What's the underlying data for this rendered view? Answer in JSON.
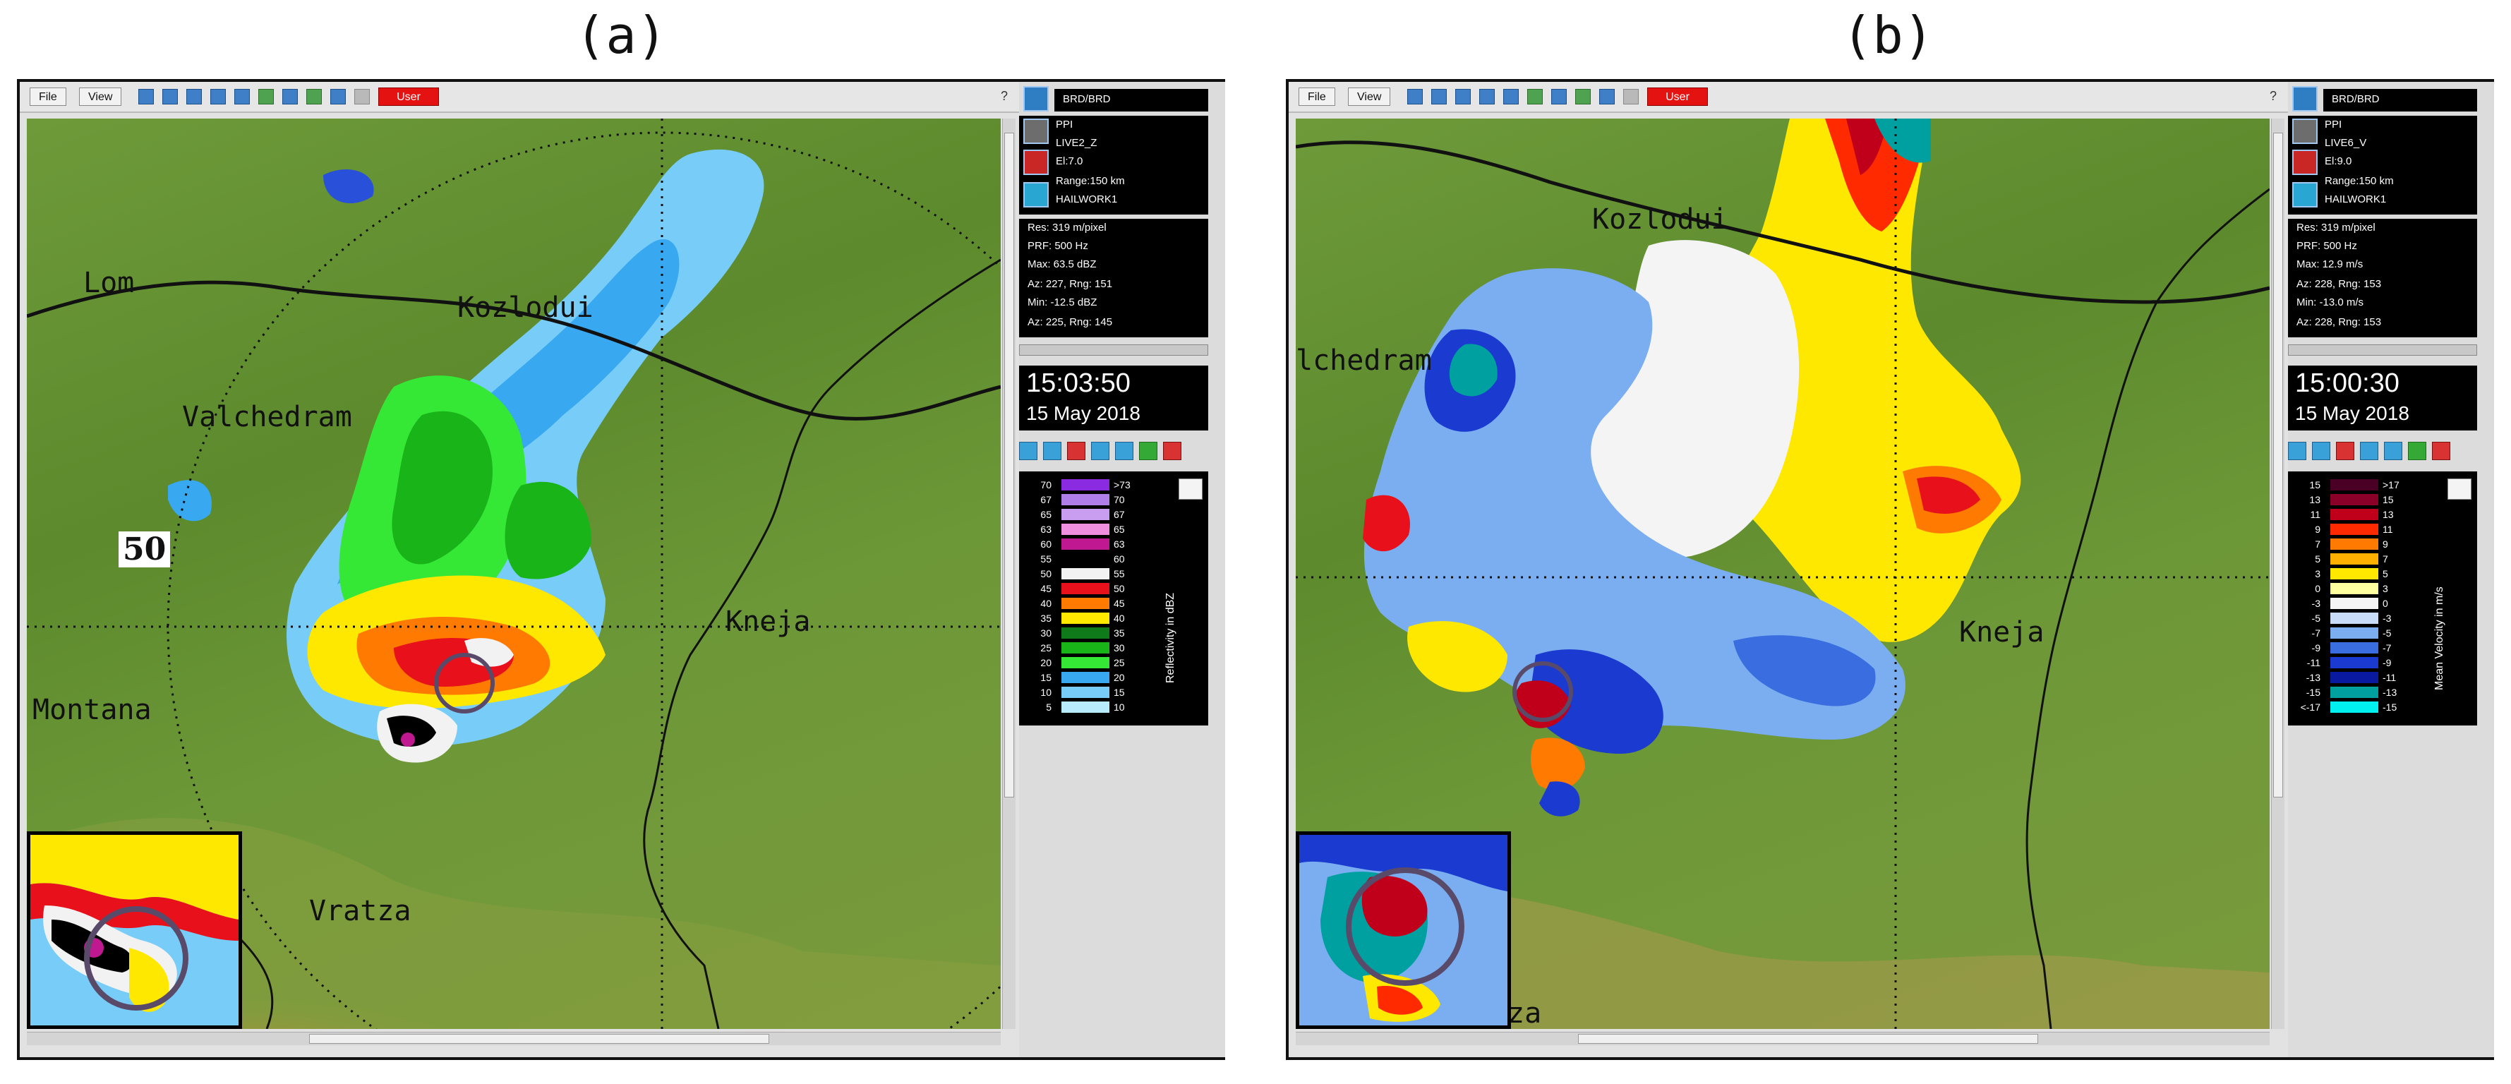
{
  "panels": [
    {
      "id": "a",
      "label": "(a)",
      "toolbar": {
        "file_label": "File",
        "view_label": "View",
        "user_label": "User",
        "help_label": "?"
      },
      "site": "BRD/BRD",
      "scan_type": "PPI",
      "product": "LIVE2_Z",
      "elevation": "El:7.0",
      "range": "Range:150 km",
      "task": "HAILWORK1",
      "stats": [
        "Res: 319 m/pixel",
        "PRF: 500 Hz",
        "Max: 63.5 dBZ",
        "Az:  227, Rng: 151",
        "Min: -12.5 dBZ",
        "Az:  225, Rng: 145"
      ],
      "time": "15:03:50",
      "date": "15 May 2018",
      "legend_title": "Reflectivity in dBZ",
      "legend": [
        {
          "left": "70",
          "color": "#8a2be2",
          "right": ">73"
        },
        {
          "left": "67",
          "color": "#b07ee8",
          "right": "70"
        },
        {
          "left": "65",
          "color": "#c99ef0",
          "right": "67"
        },
        {
          "left": "63",
          "color": "#f08ee0",
          "right": "65"
        },
        {
          "left": "60",
          "color": "#c01890",
          "right": "63"
        },
        {
          "left": "55",
          "color": "#000000",
          "right": "60"
        },
        {
          "left": "50",
          "color": "#f2f2f2",
          "right": "55"
        },
        {
          "left": "45",
          "color": "#e8101a",
          "right": "50"
        },
        {
          "left": "40",
          "color": "#ff7a00",
          "right": "45"
        },
        {
          "left": "35",
          "color": "#ffe800",
          "right": "40"
        },
        {
          "left": "30",
          "color": "#0f7a1a",
          "right": "35"
        },
        {
          "left": "25",
          "color": "#18b418",
          "right": "30"
        },
        {
          "left": "20",
          "color": "#36e836",
          "right": "25"
        },
        {
          "left": "15",
          "color": "#38a8f0",
          "right": "20"
        },
        {
          "left": "10",
          "color": "#78ccf8",
          "right": "15"
        },
        {
          "left": "5",
          "color": "#b8ecfc",
          "right": "10"
        }
      ],
      "places": [
        "Lom",
        "Kozlodui",
        "Valchedram",
        "Kneja",
        "Montana",
        "Vratza"
      ],
      "ring_label": "50"
    },
    {
      "id": "b",
      "label": "(b)",
      "toolbar": {
        "file_label": "File",
        "view_label": "View",
        "user_label": "User",
        "help_label": "?"
      },
      "site": "BRD/BRD",
      "scan_type": "PPI",
      "product": "LIVE6_V",
      "elevation": "El:9.0",
      "range": "Range:150 km",
      "task": "HAILWORK1",
      "stats": [
        "Res: 319 m/pixel",
        "PRF: 500 Hz",
        "Max: 12.9 m/s",
        "Az:  228, Rng: 153",
        "Min: -13.0 m/s",
        "Az:  228, Rng: 153"
      ],
      "time": "15:00:30",
      "date": "15 May 2018",
      "legend_title": "Mean Velocity in m/s",
      "legend": [
        {
          "left": "15",
          "color": "#4a0024",
          "right": ">17"
        },
        {
          "left": "13",
          "color": "#8a0028",
          "right": "15"
        },
        {
          "left": "11",
          "color": "#c0001a",
          "right": "13"
        },
        {
          "left": "9",
          "color": "#ff2a00",
          "right": "11"
        },
        {
          "left": "7",
          "color": "#ff7a00",
          "right": "9"
        },
        {
          "left": "5",
          "color": "#ffb000",
          "right": "7"
        },
        {
          "left": "3",
          "color": "#ffe800",
          "right": "5"
        },
        {
          "left": "0",
          "color": "#ffffa0",
          "right": "3"
        },
        {
          "left": "-3",
          "color": "#f4f4f4",
          "right": "0"
        },
        {
          "left": "-5",
          "color": "#c8dcf8",
          "right": "-3"
        },
        {
          "left": "-7",
          "color": "#7aaef0",
          "right": "-5"
        },
        {
          "left": "-9",
          "color": "#3a6ee0",
          "right": "-7"
        },
        {
          "left": "-11",
          "color": "#1a3ad0",
          "right": "-9"
        },
        {
          "left": "-13",
          "color": "#0a1aa0",
          "right": "-11"
        },
        {
          "left": "-15",
          "color": "#00a0a0",
          "right": "-13"
        },
        {
          "left": "<-17",
          "color": "#00f0f0",
          "right": "-15"
        }
      ],
      "places": [
        "Kozlodui",
        "lchedram",
        "Kneja",
        "za"
      ]
    }
  ]
}
